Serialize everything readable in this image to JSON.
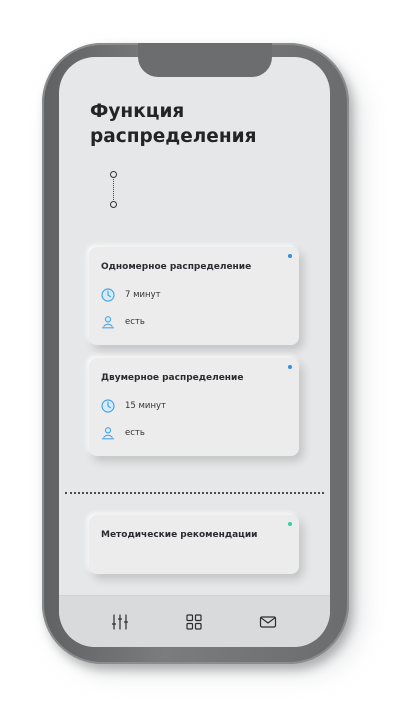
{
  "header": {
    "title": "Функция распределения"
  },
  "cards": [
    {
      "title": "Одномерное распределение",
      "duration": "7 минут",
      "availability": "есть",
      "accent_color": "#2f8ee6",
      "duration_icon": "clock-icon",
      "availability_icon": "user-location-icon"
    },
    {
      "title": "Двумерное распределение",
      "duration": "15 минут",
      "availability": "есть",
      "accent_color": "#2f8ee6",
      "duration_icon": "clock-icon",
      "availability_icon": "user-location-icon"
    }
  ],
  "recommendations_card": {
    "title": "Методические рекомендации",
    "accent_color": "#35cfa6"
  },
  "tabbar": {
    "items": [
      {
        "icon": "sliders-icon"
      },
      {
        "icon": "grid-icon"
      },
      {
        "icon": "mail-icon"
      }
    ]
  },
  "colors": {
    "icon_blue": "#4aa3e6",
    "screen_bg": "#e6e7e8",
    "frame": "#6b6d6f"
  }
}
